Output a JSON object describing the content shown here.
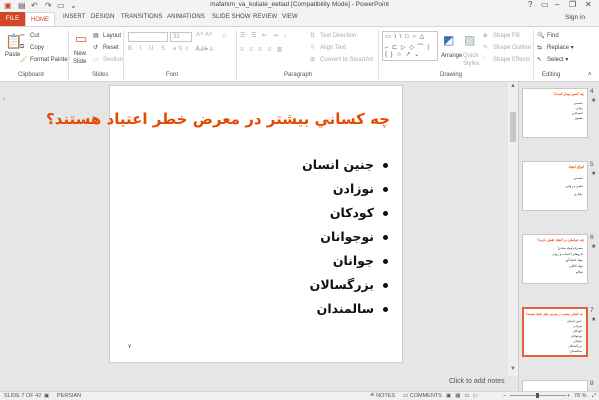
{
  "window": {
    "title": "mafahim_va_koliate_eetiad [Compatibility Mode] - PowerPoint",
    "help": "?",
    "minimize": "–",
    "restore": "❐",
    "close": "✕"
  },
  "ribbon_tabs": [
    "FILE",
    "HOME",
    "INSERT",
    "DESIGN",
    "TRANSITIONS",
    "ANIMATIONS",
    "SLIDE SHOW",
    "REVIEW",
    "VIEW"
  ],
  "signin": "Sign in",
  "clipboard": {
    "paste": "Paste",
    "cut": "Cut",
    "copy": "Copy",
    "format_painter": "Format Painter",
    "label": "Clipboard"
  },
  "slides_group": {
    "new_slide_1": "New",
    "new_slide_2": "Slide",
    "layout": "Layout",
    "reset": "Reset",
    "section": "Section",
    "label": "Slides"
  },
  "font_group": {
    "size": "32",
    "label": "Font"
  },
  "paragraph_group": {
    "text_direction": "Text Direction",
    "align_text": "Align Text",
    "convert_smartart": "Convert to SmartArt",
    "label": "Paragraph"
  },
  "drawing_group": {
    "arrange": "Arrange",
    "quick_styles_1": "Quick",
    "quick_styles_2": "Styles",
    "shape_fill": "Shape Fill",
    "shape_outline": "Shape Outline",
    "shape_effects": "Shape Effects",
    "label": "Drawing"
  },
  "editing_group": {
    "find": "Find",
    "replace": "Replace",
    "select": "Select",
    "label": "Editing"
  },
  "slide": {
    "title": "چه کساني بيشتر در معرض خطر اعتياد هستند؟",
    "bullets": [
      "جنين انسان",
      "نوزادن",
      "کودکان",
      "نوجوانان",
      "جوانان",
      "بزرگسالان",
      "سالمندان"
    ],
    "number": "۷"
  },
  "notes_hint": "Click to add notes",
  "thumbnails": [
    {
      "num": "4",
      "title": "چه کسي بيمار است؟",
      "lines": [
        "جسمي",
        "رواني",
        "اجتماعي",
        "معنوي"
      ]
    },
    {
      "num": "5",
      "title": "انواع اعتياد",
      "lines": [
        "جسمي",
        "ذهني و رواني",
        "رفتاري"
      ]
    },
    {
      "num": "6",
      "title": "چه عواملي در اعتياد نقش دارند؟",
      "lines": [
        "مصرف(مواد مخدر)",
        "داروهاي اعصاب و روان",
        "مواد اعتيادآور",
        "مواد الکلي",
        "تنباکو"
      ]
    },
    {
      "num": "7",
      "title": "چه کساني بيشتر در معرض خطر اعتياد هستند؟",
      "lines": [
        "جنين انسان",
        "نوزادن",
        "کودکان",
        "نوجوانان",
        "جوانان",
        "بزرگسالان",
        "سالمندان"
      ]
    },
    {
      "num": "8",
      "title": "",
      "lines": []
    }
  ],
  "status": {
    "slide_of": "SLIDE 7 OF 42",
    "language": "PERSIAN",
    "notes": "NOTES",
    "comments": "COMMENTS",
    "zoom": "78 %"
  },
  "colors": {
    "accent": "#d24726",
    "title_red": "#e64a00"
  }
}
